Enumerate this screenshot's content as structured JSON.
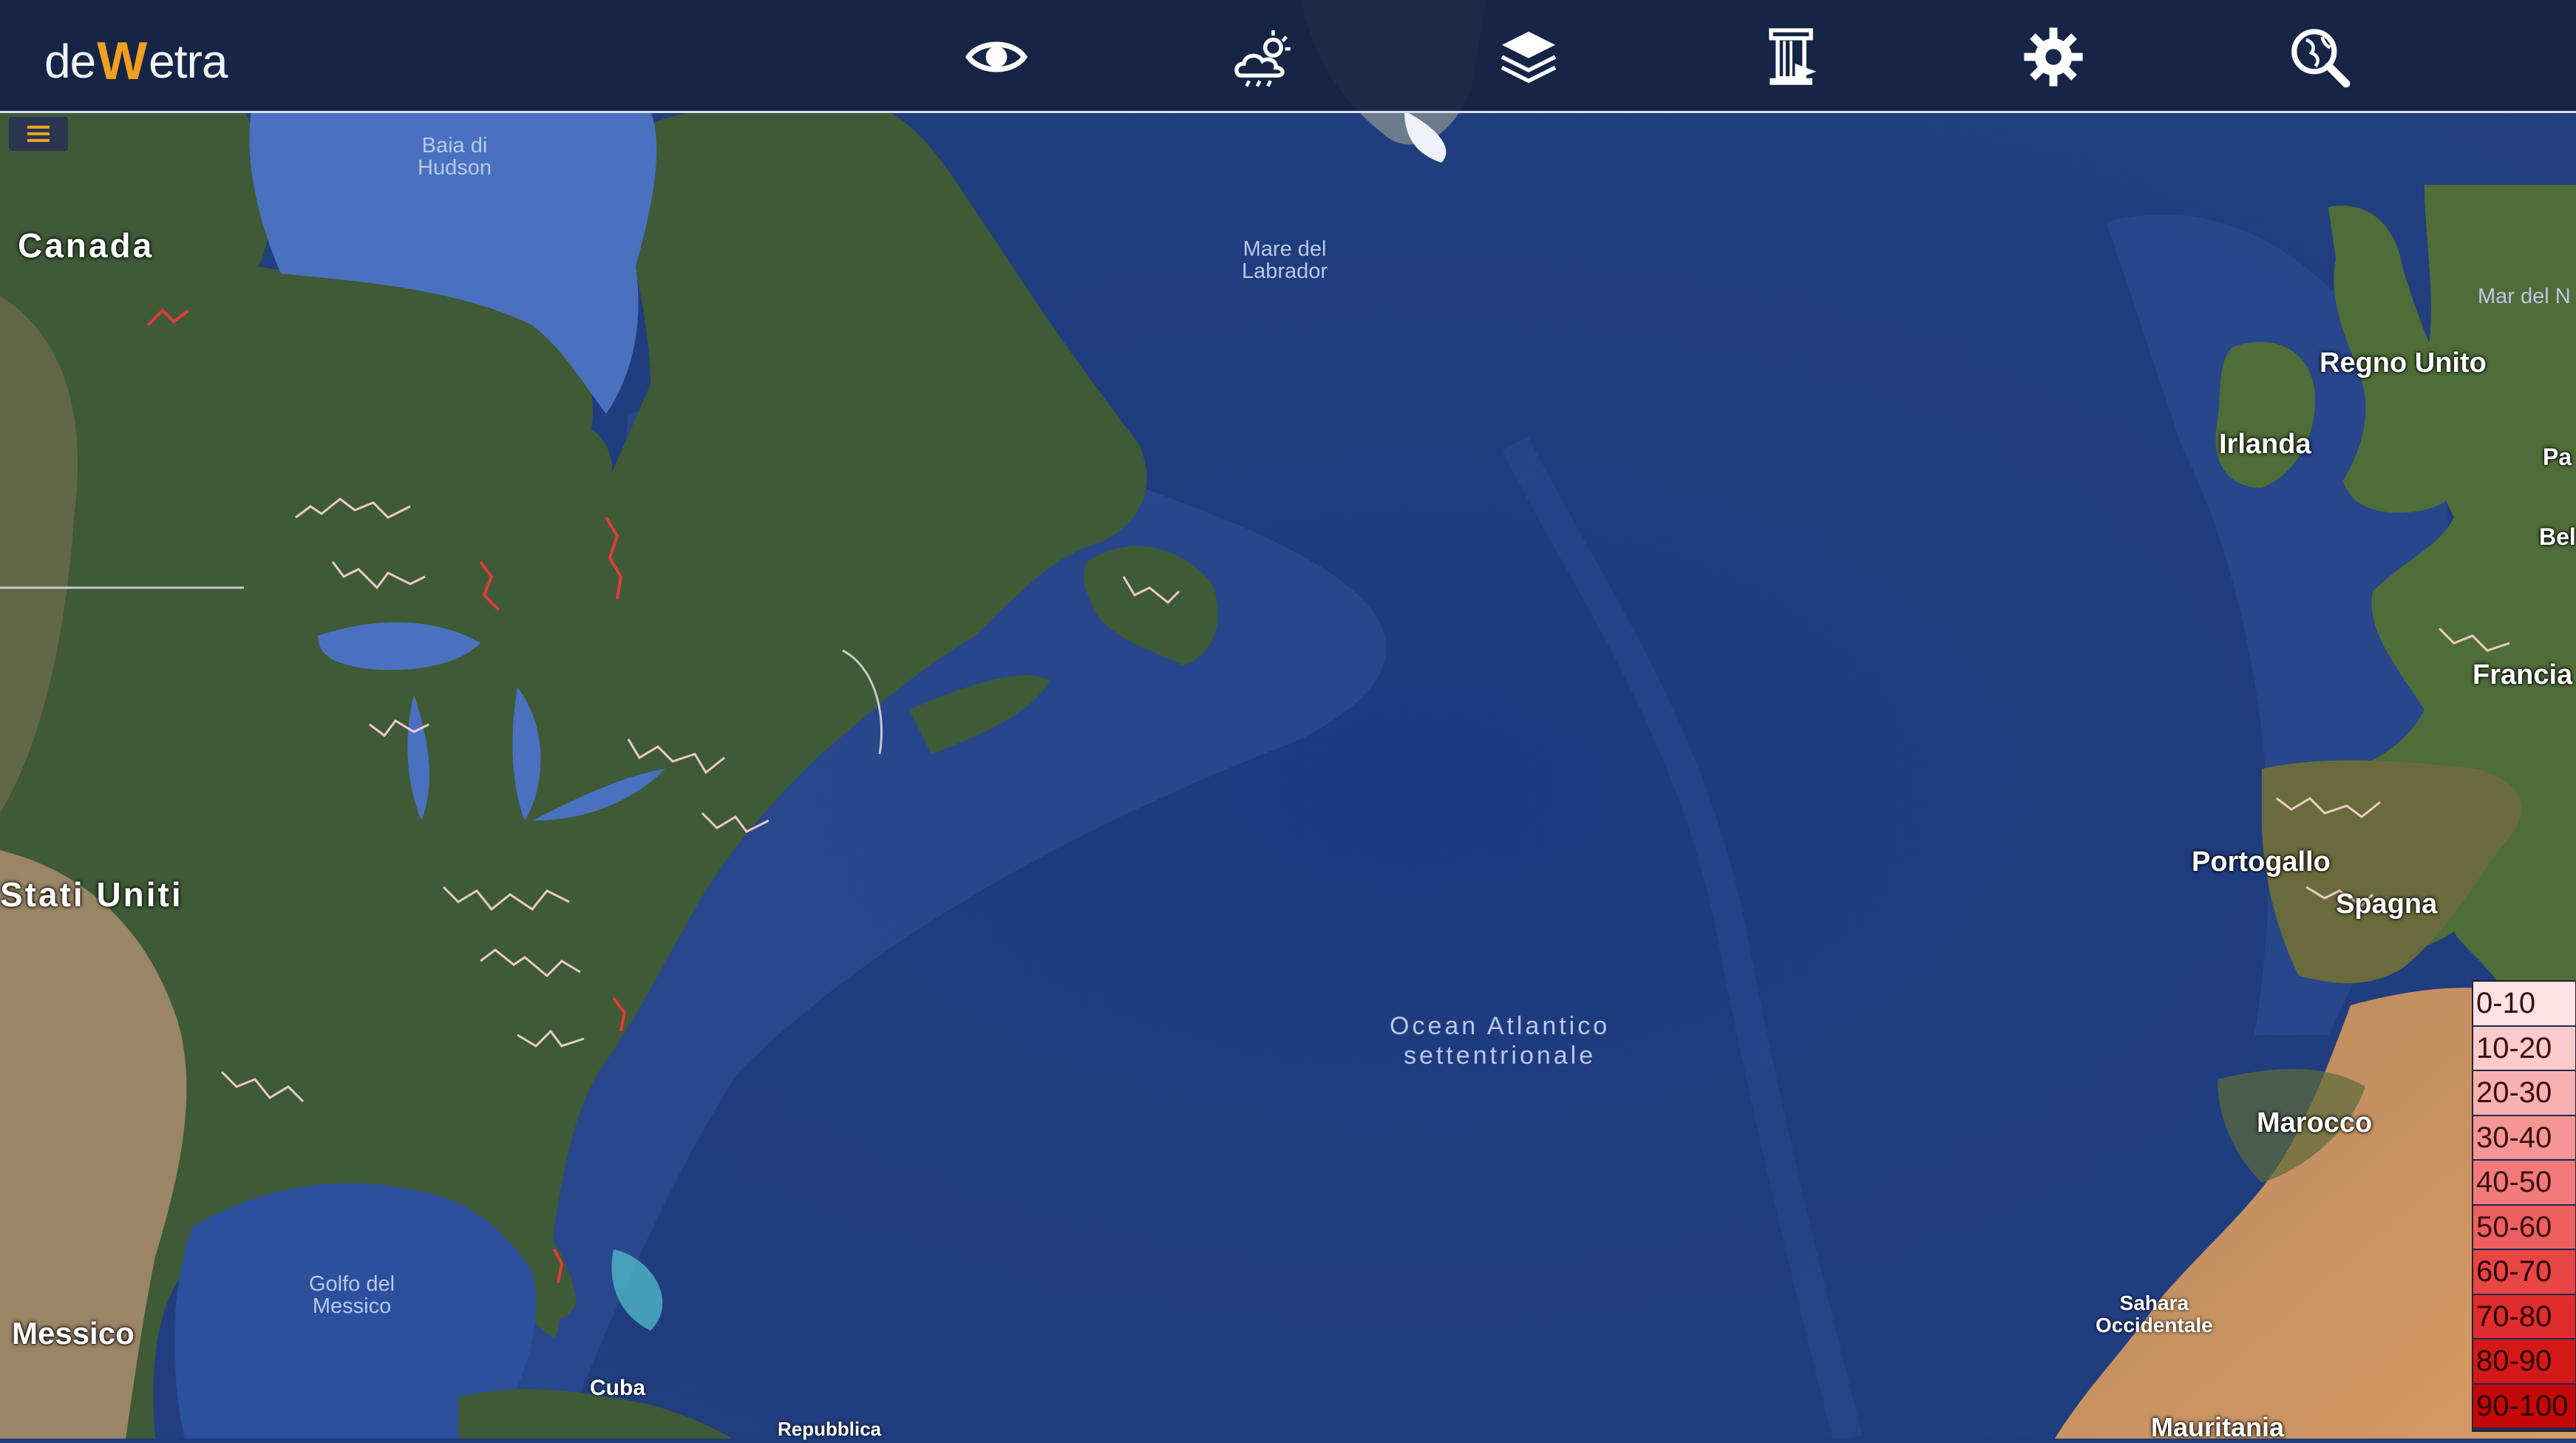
{
  "app": {
    "logo_part1": "de",
    "logo_part2": "W",
    "logo_part3": "etra"
  },
  "toolbar": {
    "buttons": [
      {
        "name": "view",
        "icon": "eye-icon"
      },
      {
        "name": "weather",
        "icon": "cloud-sun-icon"
      },
      {
        "name": "layers",
        "icon": "layers-icon"
      },
      {
        "name": "archive",
        "icon": "column-icon"
      },
      {
        "name": "settings",
        "icon": "gear-icon"
      },
      {
        "name": "search",
        "icon": "globe-search-icon"
      }
    ],
    "accent": "#f0a020"
  },
  "map": {
    "labels": {
      "canada": "Canada",
      "stati_uniti": "Stati Uniti",
      "messico": "Messico",
      "cuba": "Cuba",
      "repubblica": "Repubblica",
      "baia_l1": "Baia di",
      "baia_l2": "Hudson",
      "labrador_l1": "Mare del",
      "labrador_l2": "Labrador",
      "ocean_l1": "Ocean Atlantico",
      "ocean_l2": "settentrionale",
      "golfo_l1": "Golfo del",
      "golfo_l2": "Messico",
      "mar_del_n": "Mar del N",
      "regno_unito": "Regno Unito",
      "irlanda": "Irlanda",
      "pa": "Pa",
      "bel": "Bel",
      "francia": "Francia",
      "portogallo": "Portogallo",
      "spagna": "Spagna",
      "marocco": "Marocco",
      "sahara_l1": "Sahara",
      "sahara_l2": "Occidentale",
      "mauritania": "Mauritania"
    }
  },
  "legend": {
    "items": [
      {
        "label": "0-10",
        "color": "#fde3e3"
      },
      {
        "label": "10-20",
        "color": "#fbcaca"
      },
      {
        "label": "20-30",
        "color": "#f9b0b0"
      },
      {
        "label": "30-40",
        "color": "#f69595"
      },
      {
        "label": "40-50",
        "color": "#f27a7a"
      },
      {
        "label": "50-60",
        "color": "#ee5f5f"
      },
      {
        "label": "60-70",
        "color": "#e84545"
      },
      {
        "label": "70-80",
        "color": "#e02c2c"
      },
      {
        "label": "80-90",
        "color": "#d41818"
      },
      {
        "label": "90-100",
        "color": "#c40808"
      }
    ]
  }
}
